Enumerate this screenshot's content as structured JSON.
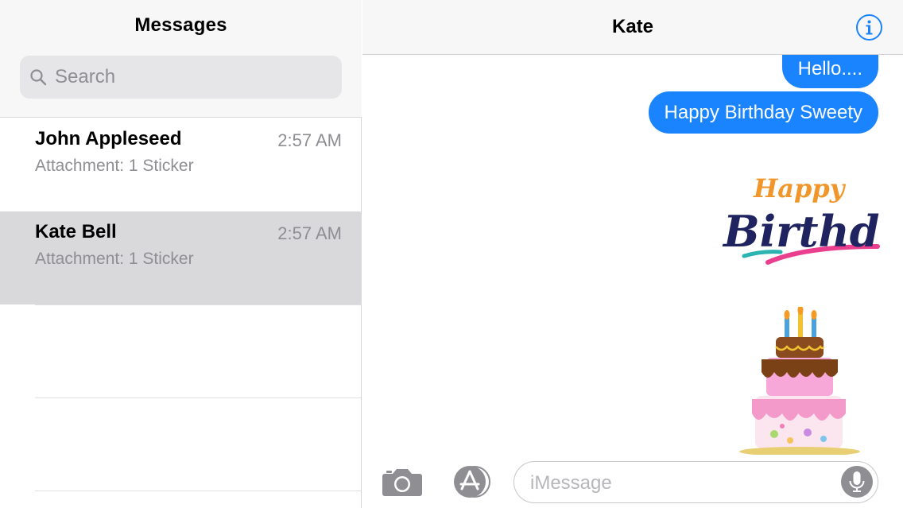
{
  "sidebar": {
    "title": "Messages",
    "search_placeholder": "Search",
    "conversations": [
      {
        "name": "John Appleseed",
        "time": "2:57 AM",
        "preview": "Attachment: 1 Sticker",
        "selected": false
      },
      {
        "name": "Kate Bell",
        "time": "2:57 AM",
        "preview": "Attachment: 1 Sticker",
        "selected": true
      }
    ]
  },
  "chat": {
    "title": "Kate",
    "messages": [
      {
        "text": "Hello....",
        "type": "sent"
      },
      {
        "text": "Happy Birthday Sweety",
        "type": "sent"
      },
      {
        "type": "sticker",
        "name": "happy-birthday-text-sticker",
        "lettering": [
          "Happy",
          "Birthday"
        ]
      },
      {
        "type": "sticker",
        "name": "birthday-cake-sticker"
      }
    ],
    "input_placeholder": "iMessage"
  },
  "icons": {
    "search": "search-icon",
    "info": "info-icon",
    "camera": "camera-icon",
    "app_store": "app-store-icon",
    "mic": "microphone-icon"
  },
  "colors": {
    "accent": "#1a84ff",
    "bubble_text": "#ffffff",
    "selected_row": "#d9d9dc",
    "secondary_text": "#8e8e93"
  }
}
